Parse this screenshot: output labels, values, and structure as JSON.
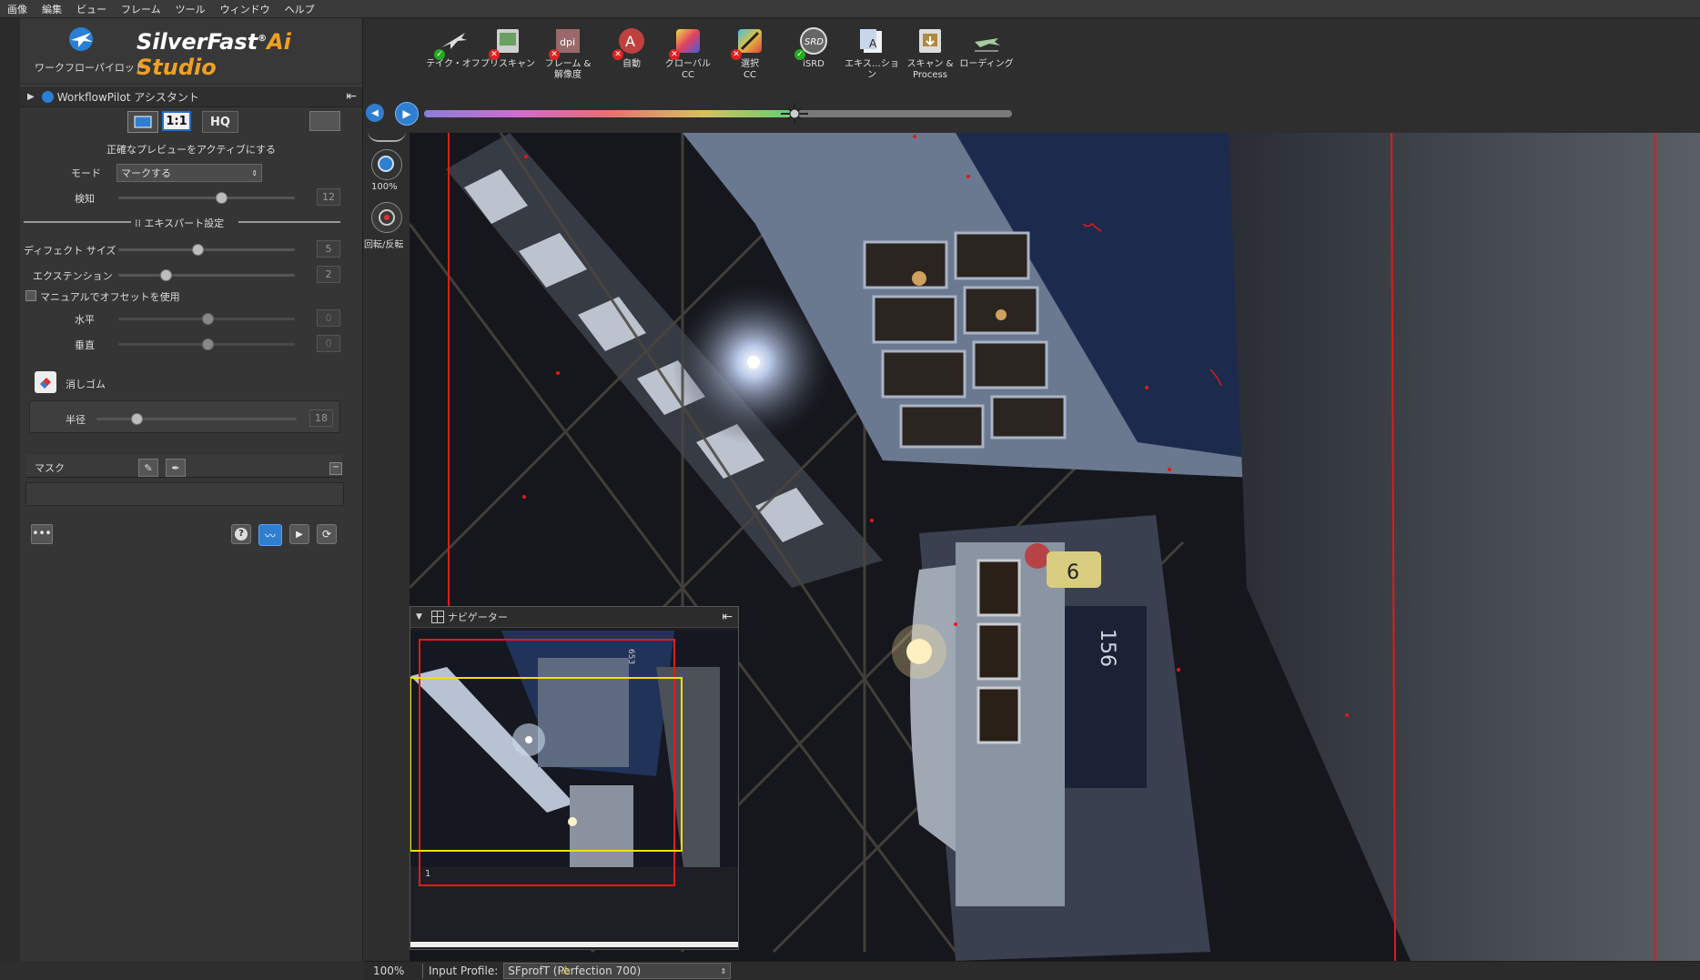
{
  "menubar": {
    "items": [
      "画像",
      "編集",
      "ビュー",
      "フレーム",
      "ツール",
      "ウィンドウ",
      "ヘルプ"
    ]
  },
  "brand": {
    "name": "SilverFast",
    "reg": "®",
    "ai": "Ai Studio",
    "workflow_label": "ワークフローパイロット"
  },
  "workflow_header": {
    "label": "WorkflowPilot アシスタント"
  },
  "preview_modes": {
    "one_to_one": "1:1",
    "hq": "HQ",
    "caption": "正確なプレビューをアクティブにする"
  },
  "settings": {
    "mode_label": "モード",
    "mode_value": "マークする",
    "detect_label": "検知",
    "detect_value": "12",
    "detect_level": 0.58,
    "expert_label": "エキスパート設定",
    "defect_label": "ディフェクト サイズ",
    "defect_value": "5",
    "defect_level": 0.45,
    "extension_label": "エクステンション",
    "extension_value": "2",
    "extension_level": 0.27,
    "manual_offset_label": "マニュアルでオフセットを使用",
    "horizontal_label": "水平",
    "horizontal_value": "0",
    "vertical_label": "垂直",
    "vertical_value": "0",
    "eraser_label": "消しゴム",
    "radius_label": "半径",
    "radius_value": "18",
    "radius_level": 0.2,
    "mask_label": "マスク"
  },
  "toolbar": {
    "items": [
      {
        "label": "テイク・オフ",
        "status": "ok",
        "icon": "plane-takeoff-icon"
      },
      {
        "label": "プリスキャン",
        "status": "x",
        "icon": "prescan-icon"
      },
      {
        "label": "フレーム &\n解像度",
        "status": "x",
        "icon": "dpi-icon"
      },
      {
        "label": "自動",
        "status": "x",
        "icon": "auto-icon"
      },
      {
        "label": "グローバル\nCC",
        "status": "x",
        "icon": "global-cc-icon"
      },
      {
        "label": "選択\nCC",
        "status": "x",
        "icon": "selective-cc-icon"
      },
      {
        "label": "iSRD",
        "status": "ok",
        "icon": "isrd-icon"
      },
      {
        "label": "エキス…ション",
        "status": "none",
        "icon": "export-icon"
      },
      {
        "label": "スキャン &\nProcess",
        "status": "none",
        "icon": "scan-process-icon"
      },
      {
        "label": "ローディング",
        "status": "none",
        "icon": "plane-landing-icon"
      }
    ],
    "dpi_text": "dpi",
    "isrd_text": "SRD",
    "progress": 0.63
  },
  "vstrip": {
    "zoom": "100%",
    "rotate_label": "回転/反転"
  },
  "navigator": {
    "title": "ナビゲーター",
    "frame_number": "1"
  },
  "preview": {
    "plate_number": "156",
    "small_number": "653",
    "route_number": "6"
  },
  "status": {
    "zoom": "100%",
    "input_profile_label": "Input Profile:",
    "input_profile_value": "SFprofT (Perfection 700)"
  },
  "colors": {
    "accent": "#3a7fd0",
    "mark_red": "#e21a1a",
    "nav_yellow": "#f2e000"
  }
}
